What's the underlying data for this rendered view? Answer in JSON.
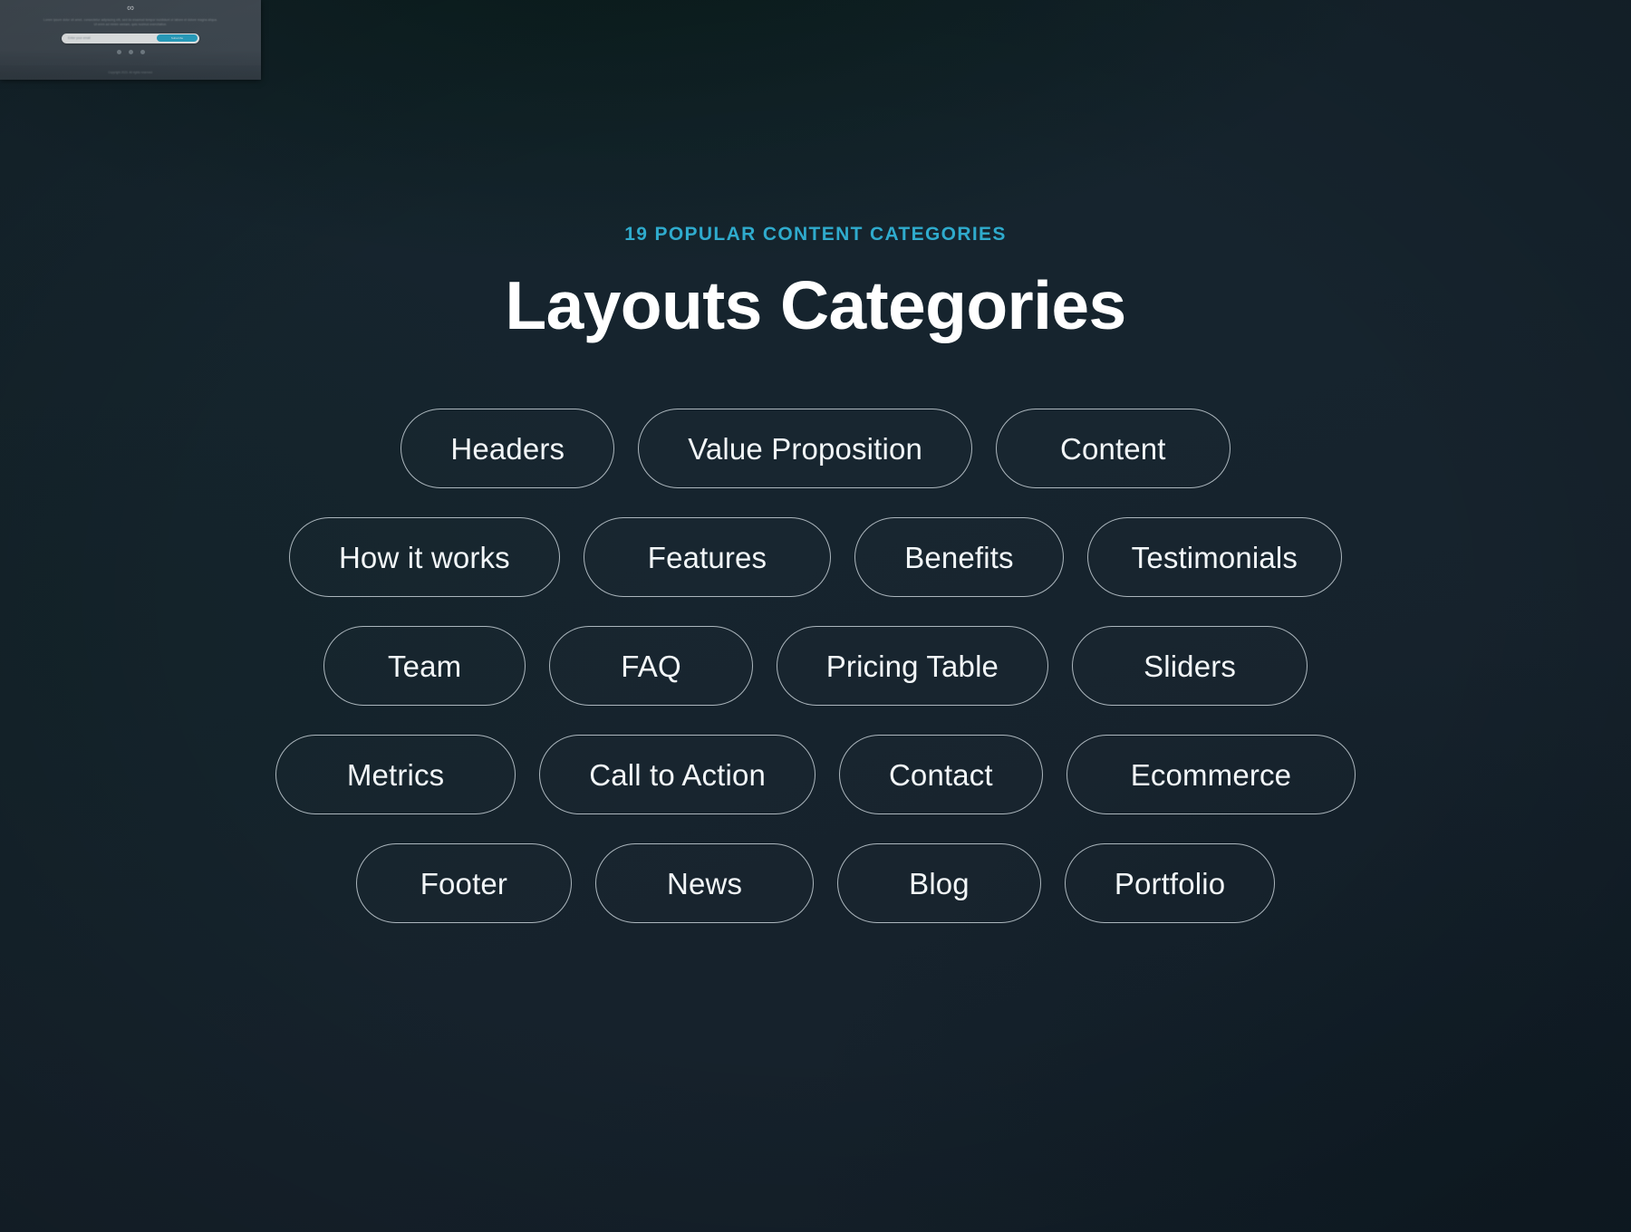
{
  "background": {
    "base_color": "#16242e",
    "accent_color": "#2fabcd"
  },
  "thumbnail": {
    "name": "landing-page-preview",
    "logo_glyph": "∞",
    "body_text": "Lorem ipsum dolor sit amet, consectetur adipiscing elit, sed do eiusmod tempor incididunt ut labore et dolore magna aliqua. Ut enim ad minim veniam, quis nostrud exercitation.",
    "email_placeholder": "Enter your email",
    "subscribe_label": "Subscribe",
    "social_dots": 3,
    "footer_text": "Copyright 2023. All rights reserved."
  },
  "section": {
    "eyebrow": "19 POPULAR CONTENT CATEGORIES",
    "heading": "Layouts Categories"
  },
  "categories": {
    "rows": [
      [
        {
          "label": "Headers",
          "size": "normal"
        },
        {
          "label": "Value Proposition",
          "size": "normal"
        },
        {
          "label": "Content",
          "size": "wide"
        }
      ],
      [
        {
          "label": "How it works",
          "size": "normal"
        },
        {
          "label": "Features",
          "size": "wide"
        },
        {
          "label": "Benefits",
          "size": "normal"
        },
        {
          "label": "Testimonials",
          "size": "narrow"
        }
      ],
      [
        {
          "label": "Team",
          "size": "wide"
        },
        {
          "label": "FAQ",
          "size": "xwide"
        },
        {
          "label": "Pricing Table",
          "size": "normal"
        },
        {
          "label": "Sliders",
          "size": "xwide"
        }
      ],
      [
        {
          "label": "Metrics",
          "size": "xwide"
        },
        {
          "label": "Call to Action",
          "size": "normal"
        },
        {
          "label": "Contact",
          "size": "normal"
        },
        {
          "label": "Ecommerce",
          "size": "wide"
        }
      ],
      [
        {
          "label": "Footer",
          "size": "wide"
        },
        {
          "label": "News",
          "size": "xwide"
        },
        {
          "label": "Blog",
          "size": "xwide"
        },
        {
          "label": "Portfolio",
          "size": "normal"
        }
      ]
    ]
  }
}
